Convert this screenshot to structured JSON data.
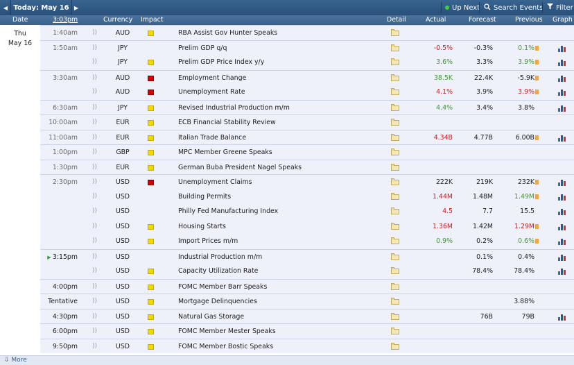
{
  "toolbar": {
    "today_label": "Today: May 16",
    "up_next": "Up Next",
    "search_events": "Search Events",
    "filter": "Filter"
  },
  "header": {
    "date": "Date",
    "time": "3:03pm",
    "currency": "Currency",
    "impact": "Impact",
    "detail": "Detail",
    "actual": "Actual",
    "forecast": "Forecast",
    "previous": "Previous",
    "graph": "Graph"
  },
  "day": {
    "weekday": "Thu",
    "date": "May 16"
  },
  "colors": {
    "better": "#3b9c2c",
    "worse": "#cc1b1b",
    "high": "#d20000",
    "medium": "#e69a36",
    "low": "#f0d900"
  },
  "events": [
    {
      "time": "1:40am",
      "currency": "AUD",
      "impact": "low",
      "event": "RBA Assist Gov Hunter Speaks",
      "actual": "",
      "actual_class": "",
      "forecast": "",
      "previous": "",
      "previous_class": "",
      "graph": false,
      "revised": false
    },
    {
      "time": "1:50am",
      "currency": "JPY",
      "impact": "medium",
      "event": "Prelim GDP q/q",
      "actual": "-0.5%",
      "actual_class": "red",
      "forecast": "-0.3%",
      "previous": "0.1%",
      "previous_class": "green",
      "graph": true,
      "revised": true
    },
    {
      "time": "",
      "currency": "JPY",
      "impact": "low",
      "event": "Prelim GDP Price Index y/y",
      "actual": "3.6%",
      "actual_class": "green",
      "forecast": "3.3%",
      "previous": "3.9%",
      "previous_class": "green",
      "graph": true,
      "revised": true
    },
    {
      "time": "3:30am",
      "currency": "AUD",
      "impact": "high",
      "event": "Employment Change",
      "actual": "38.5K",
      "actual_class": "green",
      "forecast": "22.4K",
      "previous": "-5.9K",
      "previous_class": "neutral",
      "graph": true,
      "revised": true
    },
    {
      "time": "",
      "currency": "AUD",
      "impact": "high",
      "event": "Unemployment Rate",
      "actual": "4.1%",
      "actual_class": "red",
      "forecast": "3.9%",
      "previous": "3.9%",
      "previous_class": "red",
      "graph": true,
      "revised": true
    },
    {
      "time": "6:30am",
      "currency": "JPY",
      "impact": "low",
      "event": "Revised Industrial Production m/m",
      "actual": "4.4%",
      "actual_class": "green",
      "forecast": "3.4%",
      "previous": "3.8%",
      "previous_class": "neutral",
      "graph": true,
      "revised": false
    },
    {
      "time": "10:00am",
      "currency": "EUR",
      "impact": "low",
      "event": "ECB Financial Stability Review",
      "actual": "",
      "actual_class": "",
      "forecast": "",
      "previous": "",
      "previous_class": "",
      "graph": false,
      "revised": false
    },
    {
      "time": "11:00am",
      "currency": "EUR",
      "impact": "low",
      "event": "Italian Trade Balance",
      "actual": "4.34B",
      "actual_class": "red",
      "forecast": "4.77B",
      "previous": "6.00B",
      "previous_class": "neutral",
      "graph": true,
      "revised": true
    },
    {
      "time": "1:00pm",
      "currency": "GBP",
      "impact": "low",
      "event": "MPC Member Greene Speaks",
      "actual": "",
      "actual_class": "",
      "forecast": "",
      "previous": "",
      "previous_class": "",
      "graph": false,
      "revised": false
    },
    {
      "time": "1:30pm",
      "currency": "EUR",
      "impact": "low",
      "event": "German Buba President Nagel Speaks",
      "actual": "",
      "actual_class": "",
      "forecast": "",
      "previous": "",
      "previous_class": "",
      "graph": false,
      "revised": false
    },
    {
      "time": "2:30pm",
      "currency": "USD",
      "impact": "high",
      "event": "Unemployment Claims",
      "actual": "222K",
      "actual_class": "neutral",
      "forecast": "219K",
      "previous": "232K",
      "previous_class": "neutral",
      "graph": true,
      "revised": true
    },
    {
      "time": "",
      "currency": "USD",
      "impact": "medium",
      "event": "Building Permits",
      "actual": "1.44M",
      "actual_class": "red",
      "forecast": "1.48M",
      "previous": "1.49M",
      "previous_class": "green",
      "graph": true,
      "revised": true
    },
    {
      "time": "",
      "currency": "USD",
      "impact": "medium",
      "event": "Philly Fed Manufacturing Index",
      "actual": "4.5",
      "actual_class": "red",
      "forecast": "7.7",
      "previous": "15.5",
      "previous_class": "neutral",
      "graph": true,
      "revised": false
    },
    {
      "time": "",
      "currency": "USD",
      "impact": "low",
      "event": "Housing Starts",
      "actual": "1.36M",
      "actual_class": "red",
      "forecast": "1.42M",
      "previous": "1.29M",
      "previous_class": "red",
      "graph": true,
      "revised": true
    },
    {
      "time": "",
      "currency": "USD",
      "impact": "low",
      "event": "Import Prices m/m",
      "actual": "0.9%",
      "actual_class": "green",
      "forecast": "0.2%",
      "previous": "0.6%",
      "previous_class": "green",
      "graph": true,
      "revised": true
    },
    {
      "time": "3:15pm",
      "currency": "USD",
      "impact": "medium",
      "event": "Industrial Production m/m",
      "actual": "",
      "actual_class": "",
      "forecast": "0.1%",
      "previous": "0.4%",
      "previous_class": "neutral",
      "graph": true,
      "revised": false,
      "upnext": true
    },
    {
      "time": "",
      "currency": "USD",
      "impact": "low",
      "event": "Capacity Utilization Rate",
      "actual": "",
      "actual_class": "",
      "forecast": "78.4%",
      "previous": "78.4%",
      "previous_class": "neutral",
      "graph": true,
      "revised": false
    },
    {
      "time": "4:00pm",
      "currency": "USD",
      "impact": "low",
      "event": "FOMC Member Barr Speaks",
      "actual": "",
      "actual_class": "",
      "forecast": "",
      "previous": "",
      "previous_class": "",
      "graph": false,
      "revised": false
    },
    {
      "time": "Tentative",
      "currency": "USD",
      "impact": "low",
      "event": "Mortgage Delinquencies",
      "actual": "",
      "actual_class": "",
      "forecast": "",
      "previous": "3.88%",
      "previous_class": "neutral",
      "graph": false,
      "revised": false
    },
    {
      "time": "4:30pm",
      "currency": "USD",
      "impact": "low",
      "event": "Natural Gas Storage",
      "actual": "",
      "actual_class": "",
      "forecast": "76B",
      "previous": "79B",
      "previous_class": "neutral",
      "graph": true,
      "revised": false
    },
    {
      "time": "6:00pm",
      "currency": "USD",
      "impact": "low",
      "event": "FOMC Member Mester Speaks",
      "actual": "",
      "actual_class": "",
      "forecast": "",
      "previous": "",
      "previous_class": "",
      "graph": false,
      "revised": false
    },
    {
      "time": "9:50pm",
      "currency": "USD",
      "impact": "low",
      "event": "FOMC Member Bostic Speaks",
      "actual": "",
      "actual_class": "",
      "forecast": "",
      "previous": "",
      "previous_class": "",
      "graph": false,
      "revised": false
    }
  ],
  "footer": {
    "more": "More"
  }
}
